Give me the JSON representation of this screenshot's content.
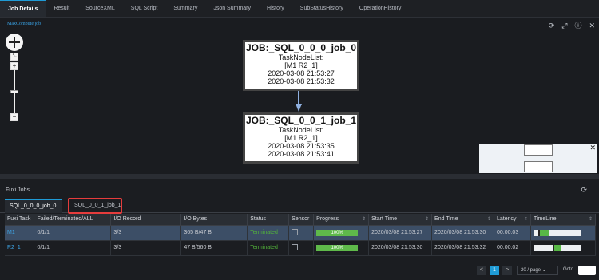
{
  "tabs": [
    "Job Details",
    "Result",
    "SourceXML",
    "SQL Script",
    "Summary",
    "Json Summary",
    "History",
    "SubStatusHistory",
    "OperationHistory"
  ],
  "graph": {
    "label": "MaxCompute job",
    "icons": [
      "refresh-icon",
      "fullscreen-icon",
      "info-icon",
      "close-icon"
    ],
    "nodes": [
      {
        "title": "JOB:_SQL_0_0_0_job_0",
        "line1": "TaskNodeList:",
        "line2": "[M1 R2_1]",
        "start": "2020-03-08 21:53:27",
        "end": "2020-03-08 21:53:32"
      },
      {
        "title": "JOB:_SQL_0_0_1_job_1",
        "line1": "TaskNodeList:",
        "line2": "[M1 R2_1]",
        "start": "2020-03-08 21:53:35",
        "end": "2020-03-08 21:53:41"
      }
    ],
    "minimap_close": "✕"
  },
  "fuxi": {
    "title": "Fuxi Jobs",
    "job_tabs": [
      "SQL_0_0_0_job_0",
      "SQL_0_0_1_job_1"
    ],
    "columns": [
      "Fuxi Task",
      "Failed/Terminated/ALL",
      "I/O Record",
      "I/O Bytes",
      "Status",
      "Sensor",
      "Progress",
      "Start Time",
      "End Time",
      "Latency",
      "TimeLine"
    ],
    "rows": [
      {
        "task": "M1",
        "ftall": "0/1/1",
        "io_record": "3/3",
        "io_bytes": "365 B/47 B",
        "status": "Terminated",
        "progress": "100%",
        "progress_value": 1.0,
        "start": "2020/03/08 21:53:27",
        "end": "2020/03/08 21:53:30",
        "latency": "00:00:03",
        "timeline": [
          0.1,
          0.3
        ]
      },
      {
        "task": "R2_1",
        "ftall": "0/1/1",
        "io_record": "3/3",
        "io_bytes": "47 B/560 B",
        "status": "Terminated",
        "progress": "100%",
        "progress_value": 1.0,
        "start": "2020/03/08 21:53:30",
        "end": "2020/03/08 21:53:32",
        "latency": "00:00:02",
        "timeline": [
          0.4,
          0.55
        ]
      }
    ]
  },
  "pager": {
    "prev": "<",
    "page": "1",
    "next": ">",
    "size": "20 / page",
    "goto": "Goto"
  }
}
